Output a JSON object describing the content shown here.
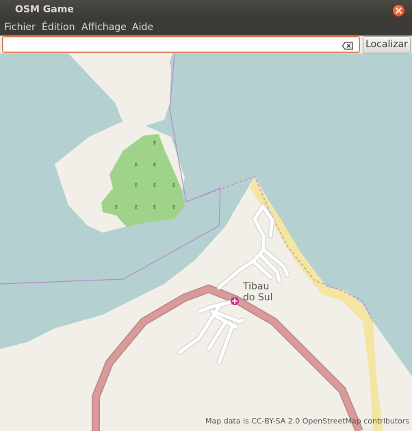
{
  "window": {
    "title": "OSM Game",
    "close_icon": "close-icon"
  },
  "menu": {
    "items": [
      "Fichier",
      "Édition",
      "Affichage",
      "Aide"
    ]
  },
  "search": {
    "value": "",
    "placeholder": "",
    "clear_icon": "clear-text-icon",
    "button_label": "Localizar"
  },
  "map": {
    "place_name_line1": "Tibau",
    "place_name_line2": "do Sul",
    "attribution": "Map data is CC-BY-SA 2.0 OpenStreetMap contributors",
    "marker_icon": "place-of-worship-icon",
    "colors": {
      "water": "#b5d0d0",
      "land": "#f2efe9",
      "forest": "#9fd38a",
      "beach": "#f4e5a2",
      "primary_road": "#d99a9a",
      "minor_road": "#ffffff",
      "boundary": "#b48ac8",
      "marker": "#d6278d"
    }
  }
}
